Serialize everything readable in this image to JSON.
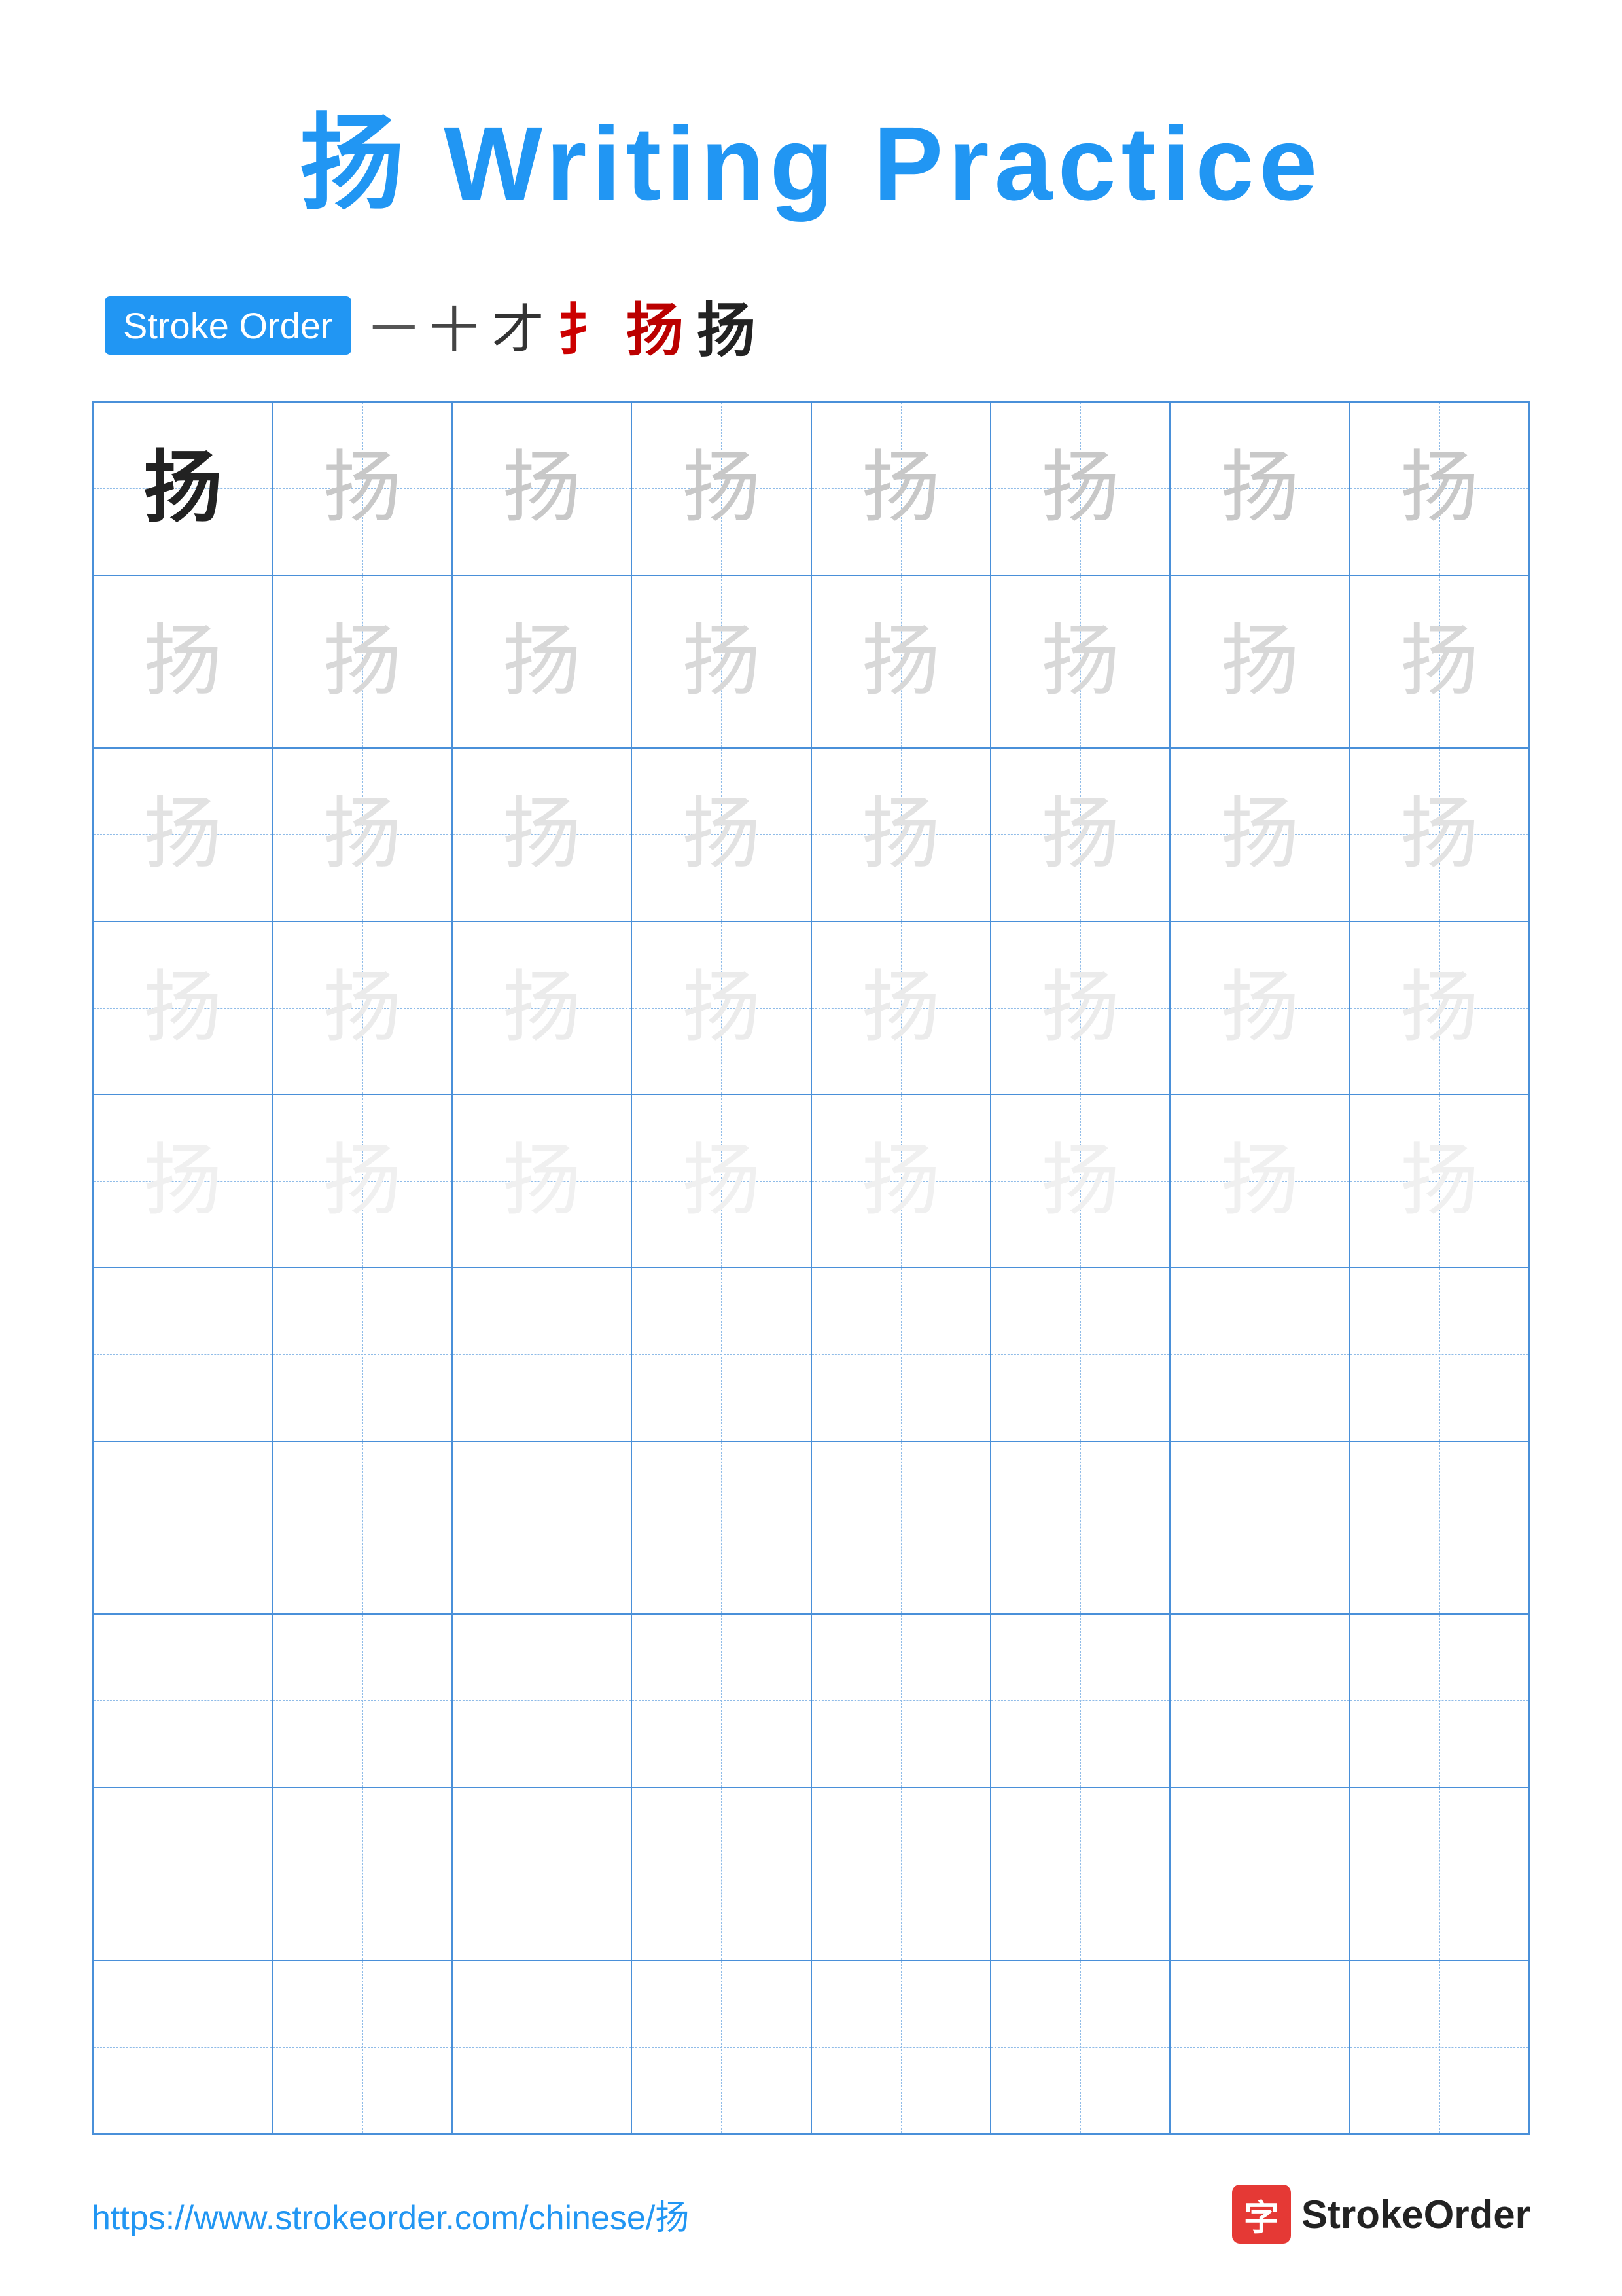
{
  "title": {
    "text": "扬 Writing Practice",
    "char": "扬"
  },
  "stroke_order": {
    "badge_label": "Stroke Order",
    "strokes": [
      "一",
      "十",
      "才",
      "扌",
      "扬",
      "扬"
    ]
  },
  "grid": {
    "rows": 10,
    "cols": 8,
    "char": "扬",
    "filled_rows": 5,
    "empty_rows": 5
  },
  "footer": {
    "url": "https://www.strokeorder.com/chinese/扬",
    "logo_icon": "字",
    "logo_name": "StrokeOrder"
  }
}
